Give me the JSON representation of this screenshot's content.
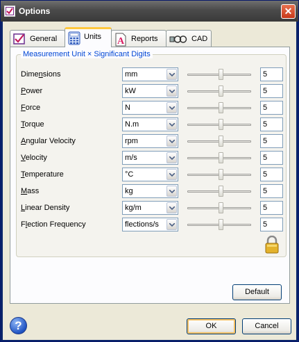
{
  "window": {
    "title": "Options",
    "close_symbol": "✕"
  },
  "tabs": [
    {
      "label": "General",
      "icon": "checkbox-form-icon"
    },
    {
      "label": "Units",
      "icon": "calculator-icon"
    },
    {
      "label": "Reports",
      "icon": "report-A-icon"
    },
    {
      "label": "CAD",
      "icon": "cad-link-icon"
    }
  ],
  "active_tab": "Units",
  "group_title": "Measurement Unit  × Significant Digits",
  "rows": [
    {
      "label": "Dimensions",
      "underline_index": 4,
      "unit": "mm",
      "digits": "5"
    },
    {
      "label": "Power",
      "underline_index": 0,
      "unit": "kW",
      "digits": "5"
    },
    {
      "label": "Force",
      "underline_index": 0,
      "unit": "N",
      "digits": "5"
    },
    {
      "label": "Torque",
      "underline_index": 0,
      "unit": "N.m",
      "digits": "5"
    },
    {
      "label": "Angular Velocity",
      "underline_index": 0,
      "unit": "rpm",
      "digits": "5"
    },
    {
      "label": "Velocity",
      "underline_index": 0,
      "unit": "m/s",
      "digits": "5"
    },
    {
      "label": "Temperature",
      "underline_index": 0,
      "unit": "°C",
      "digits": "5"
    },
    {
      "label": "Mass",
      "underline_index": 0,
      "unit": "kg",
      "digits": "5"
    },
    {
      "label": "Linear Density",
      "underline_index": 0,
      "unit": "kg/m",
      "digits": "5"
    },
    {
      "label": "Flection Frequency",
      "underline_index": 1,
      "unit": "flections/s",
      "digits": "5"
    }
  ],
  "buttons": {
    "default": "Default",
    "ok": "OK",
    "cancel": "Cancel",
    "help": "?"
  },
  "colors": {
    "accent": "#0046d5",
    "focus": "#ffc83c",
    "lock": "#d9a521"
  }
}
